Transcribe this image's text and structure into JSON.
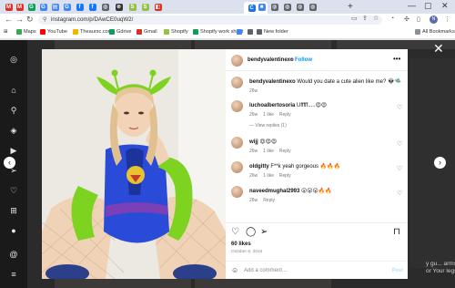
{
  "browser": {
    "url": "instagram.com/p/DAwCE0uqW2/",
    "win_minimize": "—",
    "win_maximize": "▢",
    "win_close": "✕",
    "new_tab": "+",
    "profile_initial": "N",
    "tab_close": "✕",
    "tabs": [
      {
        "icon": "M",
        "color": "#d93025"
      },
      {
        "icon": "M",
        "color": "#d93025"
      },
      {
        "icon": "G",
        "color": "#0f9d58"
      },
      {
        "icon": "G",
        "color": "#4285f4"
      },
      {
        "icon": "▤",
        "color": "#4285f4"
      },
      {
        "icon": "G",
        "color": "#4285f4"
      },
      {
        "icon": "f",
        "color": "#1877f2"
      },
      {
        "icon": "f",
        "color": "#1877f2"
      },
      {
        "icon": "◍",
        "color": "#5f6368"
      },
      {
        "icon": "⊗",
        "color": "#333"
      },
      {
        "icon": "S",
        "color": "#95bf47"
      },
      {
        "icon": "S",
        "color": "#95bf47"
      },
      {
        "icon": "◧",
        "color": "#d93025"
      },
      {
        "icon": "C",
        "color": "#1a73e8"
      },
      {
        "icon": "■",
        "color": "#4285f4"
      },
      {
        "icon": "◍",
        "color": "#5f6368"
      },
      {
        "icon": "◍",
        "color": "#5f6368"
      },
      {
        "icon": "◍",
        "color": "#5f6368"
      },
      {
        "icon": "◍",
        "color": "#5f6368"
      }
    ]
  },
  "bookmarks": [
    {
      "label": "Maps",
      "color": "#34a853"
    },
    {
      "label": "YouTube",
      "color": "#ff0000"
    },
    {
      "label": "Theaursc.com",
      "color": "#f4b400"
    },
    {
      "label": "Gdrive",
      "color": "#0f9d58"
    },
    {
      "label": "Gmail",
      "color": "#d93025"
    },
    {
      "label": "Shopify",
      "color": "#95bf47"
    },
    {
      "label": "Shopify work sheet",
      "color": "#0f9d58"
    },
    {
      "label": "",
      "color": "#4285f4"
    },
    {
      "label": "",
      "color": "#5f6368"
    },
    {
      "label": "New folder",
      "color": "#5f6368"
    }
  ],
  "all_bookmarks": "All Bookmarks",
  "post": {
    "username": "bendyvalentinexo",
    "follow_label": "Follow",
    "caption": "Would you date a cute alien like me? 👽🛸",
    "caption_time": "26w",
    "comments": [
      {
        "user": "luchoalbertosoria",
        "text": "Ufffff.....😍😍",
        "time": "26w",
        "likes": "1 like",
        "reply": "Reply",
        "view_replies": "View replies (1)"
      },
      {
        "user": "wijj",
        "text": "😍😍😍",
        "time": "26w",
        "likes": "1 like",
        "reply": "Reply"
      },
      {
        "user": "oldgitty",
        "text": "F**k yeah gorgeous 🔥🔥🔥",
        "time": "26w",
        "likes": "1 like",
        "reply": "Reply"
      },
      {
        "user": "naveedmughal2993",
        "text": "😮😮😮🔥🔥",
        "time": "26w",
        "likes": "",
        "reply": "Reply"
      }
    ],
    "likes": "60 likes",
    "date": "October 6, 2024",
    "comment_placeholder": "Add a comment...",
    "post_button": "Post"
  },
  "background_text": "y gu... arms or Your legs?",
  "colors": {
    "follow_blue": "#0095f6",
    "sidebar_bg": "#1a1a1a"
  }
}
